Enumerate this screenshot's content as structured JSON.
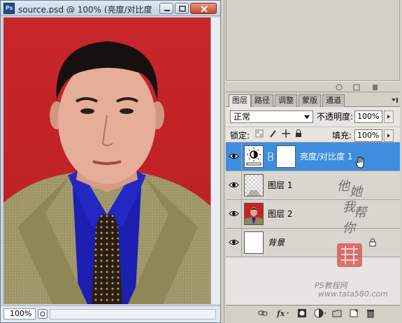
{
  "window": {
    "title": "source.psd @ 100% (亮度/对比度 ...",
    "app_icon_label": "Ps",
    "zoom": "100%"
  },
  "layers_panel": {
    "tabs": [
      {
        "label": "图层",
        "active": true
      },
      {
        "label": "路径",
        "active": false
      },
      {
        "label": "调整",
        "active": false
      },
      {
        "label": "蒙版",
        "active": false
      },
      {
        "label": "通道",
        "active": false
      }
    ],
    "blend_mode": "正常",
    "opacity_label": "不透明度:",
    "opacity_value": "100%",
    "lock_label": "锁定:",
    "fill_label": "填充:",
    "fill_value": "100%",
    "layers": [
      {
        "name": "亮度/对比度 1",
        "selected": true,
        "kind": "adjustment",
        "visible": true
      },
      {
        "name": "图层 1",
        "selected": false,
        "kind": "transparent",
        "visible": true
      },
      {
        "name": "图层 2",
        "selected": false,
        "kind": "photo",
        "visible": true
      },
      {
        "name": "背景",
        "selected": false,
        "kind": "background",
        "visible": true,
        "locked": true
      }
    ]
  },
  "watermark": {
    "chars": [
      "他",
      "她",
      "我",
      "帮",
      "你"
    ],
    "site_line1": "PS教程网",
    "site_line2": "www.tata580.com"
  },
  "colors": {
    "selection": "#3d8ee0",
    "photo_background": "#c42428"
  },
  "icons": [
    "photoshop-app-icon",
    "minimize-icon",
    "maximize-icon",
    "close-icon",
    "eye-icon",
    "chain-link-icon",
    "lock-icon",
    "link-layers-icon",
    "fx-icon",
    "mask-icon",
    "adjustment-icon",
    "folder-icon",
    "new-layer-icon",
    "trash-icon"
  ]
}
